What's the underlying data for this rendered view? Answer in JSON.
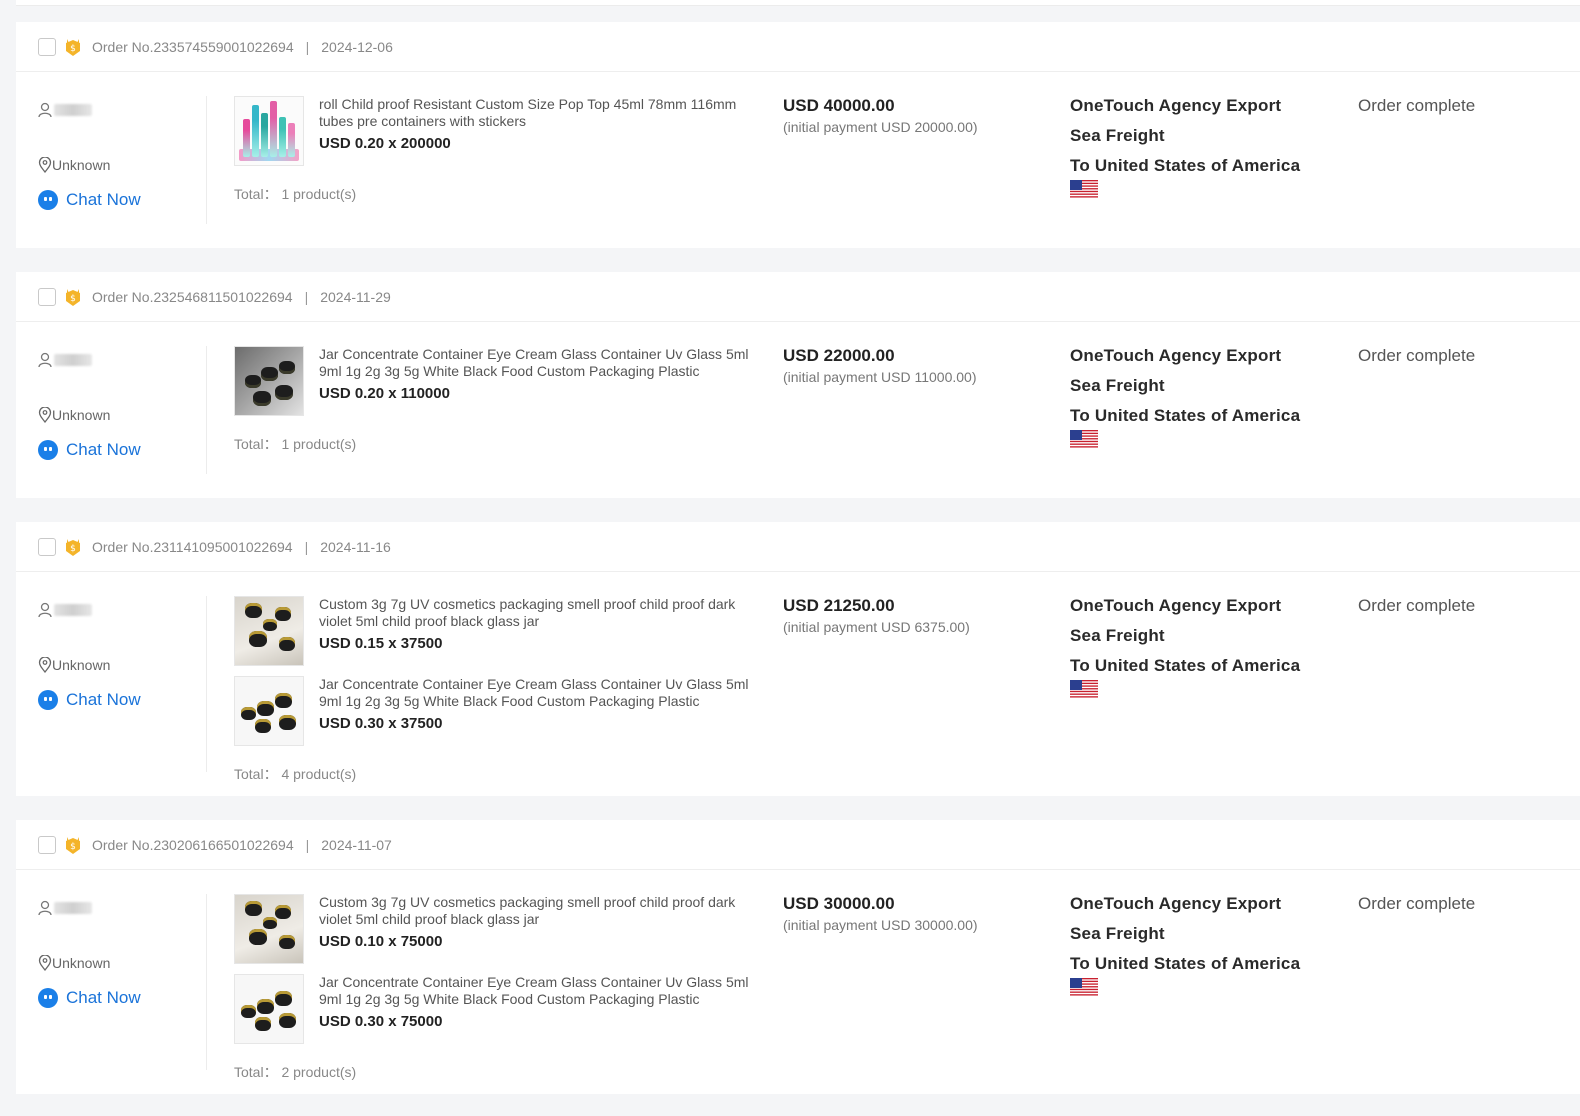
{
  "orders": [
    {
      "order_no": "Order No.233574559001022694",
      "date": "2024-12-06",
      "location": "Unknown",
      "chat_label": "Chat Now",
      "products": [
        {
          "title": "roll Child proof Resistant Custom Size Pop Top 45ml 78mm 116mm tubes pre containers with stickers",
          "price": "USD 0.20 x 200000",
          "thumb": "tubes"
        }
      ],
      "total": "Total： 1 product(s)",
      "amount": "USD 40000.00",
      "initial_payment": "(initial payment USD 20000.00)",
      "agency": "OneTouch Agency Export",
      "freight": "Sea Freight",
      "destination": "To United States of America",
      "flag_icon": "us-flag-icon",
      "status": "Order complete"
    },
    {
      "order_no": "Order No.232546811501022694",
      "date": "2024-11-29",
      "location": "Unknown",
      "chat_label": "Chat Now",
      "products": [
        {
          "title": "Jar Concentrate Container Eye Cream Glass Container Uv Glass 5ml 9ml 1g 2g 3g 5g White Black Food Custom Packaging Plastic",
          "price": "USD 0.20 x 110000",
          "thumb": "black-jars"
        }
      ],
      "total": "Total： 1 product(s)",
      "amount": "USD 22000.00",
      "initial_payment": "(initial payment USD 11000.00)",
      "agency": "OneTouch Agency Export",
      "freight": "Sea Freight",
      "destination": "To United States of America",
      "flag_icon": "us-flag-icon",
      "status": "Order complete"
    },
    {
      "order_no": "Order No.231141095001022694",
      "date": "2024-11-16",
      "location": "Unknown",
      "chat_label": "Chat Now",
      "products": [
        {
          "title": "Custom 3g 7g UV cosmetics packaging smell proof child proof dark violet 5ml child proof black glass jar",
          "price": "USD 0.15 x 37500",
          "thumb": "gold-jars"
        },
        {
          "title": "Jar Concentrate Container Eye Cream Glass Container Uv Glass 5ml 9ml 1g 2g 3g 5g White Black Food Custom Packaging Plastic",
          "price": "USD 0.30 x 37500",
          "thumb": "black-jars-white"
        }
      ],
      "total": "Total： 4 product(s)",
      "amount": "USD 21250.00",
      "initial_payment": "(initial payment USD 6375.00)",
      "agency": "OneTouch Agency Export",
      "freight": "Sea Freight",
      "destination": "To United States of America",
      "flag_icon": "us-flag-icon",
      "status": "Order complete"
    },
    {
      "order_no": "Order No.230206166501022694",
      "date": "2024-11-07",
      "location": "Unknown",
      "chat_label": "Chat Now",
      "products": [
        {
          "title": "Custom 3g 7g UV cosmetics packaging smell proof child proof dark violet 5ml child proof black glass jar",
          "price": "USD 0.10 x 75000",
          "thumb": "gold-jars"
        },
        {
          "title": "Jar Concentrate Container Eye Cream Glass Container Uv Glass 5ml 9ml 1g 2g 3g 5g White Black Food Custom Packaging Plastic",
          "price": "USD 0.30 x 75000",
          "thumb": "black-jars-white"
        }
      ],
      "total": "Total： 2 product(s)",
      "amount": "USD 30000.00",
      "initial_payment": "(initial payment USD 30000.00)",
      "agency": "OneTouch Agency Export",
      "freight": "Sea Freight",
      "destination": "To United States of America",
      "flag_icon": "us-flag-icon",
      "status": "Order complete"
    }
  ],
  "colors": {
    "link": "#1a73d9",
    "medal": "#f2b32a"
  }
}
